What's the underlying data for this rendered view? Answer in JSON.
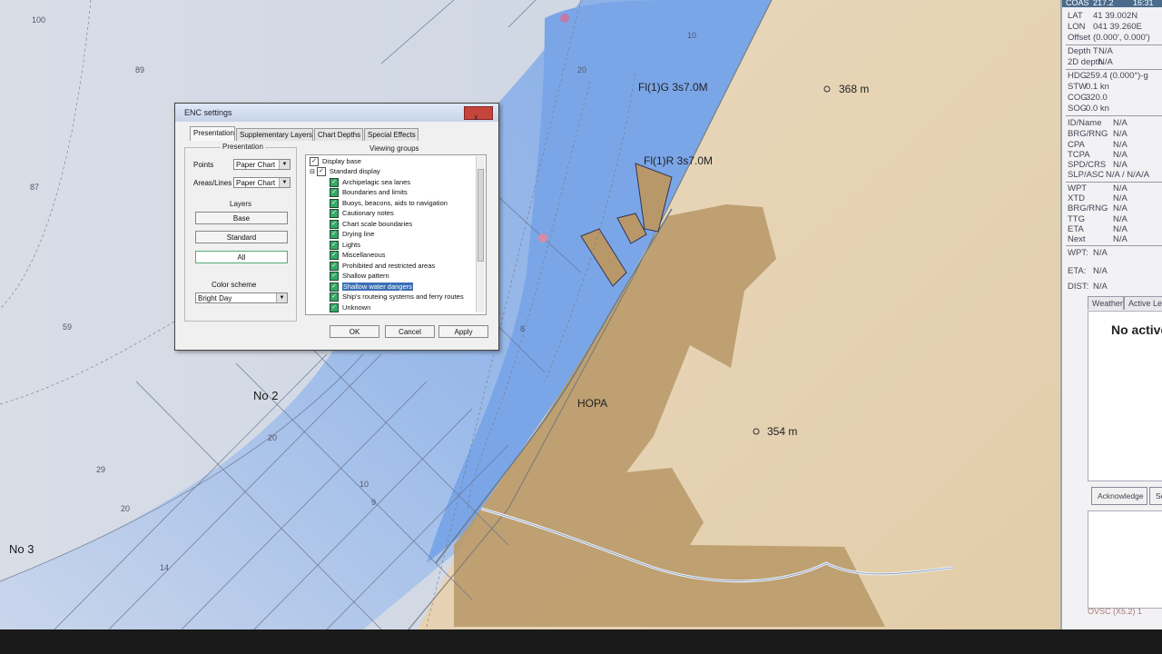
{
  "chart_labels": {
    "light1": "Fl(1)G 3s7.0M",
    "light2": "Fl(1)R 3s7.0M",
    "height1": "368 m",
    "height2": "354 m",
    "town": "HOPA",
    "area_no2": "No 2",
    "area_no3": "No 3",
    "depths": [
      "100",
      "89",
      "87",
      "59",
      "29",
      "20",
      "20",
      "10",
      "9",
      "14",
      "20",
      "8",
      "10"
    ]
  },
  "panel": {
    "top": [
      "COAS",
      "217.2",
      "16:31"
    ],
    "lat_k": "LAT",
    "lat_v": "41 39.002N",
    "lon_k": "LON",
    "lon_v": "041 39.260E",
    "off_k": "Offset",
    "off_v": "(0.000', 0.000')",
    "dep_k": "Depth T",
    "dep_v": "N/A",
    "d2_k": "2D depth",
    "d2_v": "N/A",
    "hdg_k": "HDG",
    "hdg_v": "259.4 (0.000°)-g",
    "stw_k": "STW",
    "stw_v": "0.1 kn",
    "cog_k": "COG",
    "cog_v": "320.0",
    "sog_k": "SOG",
    "sog_v": "0.0 kn",
    "id_k": "ID/Name",
    "id_v": "N/A",
    "brg_k": "BRG/RNG",
    "brg_v": "N/A",
    "cpa_k": "CPA",
    "cpa_v": "N/A",
    "tcpa_k": "TCPA",
    "tcpa_v": "N/A",
    "spd_k": "SPD/CRS",
    "spd_v": "N/A",
    "slp_k": "SLP/ASC",
    "slp_v": "N/A / N/A/A",
    "wpt_k": "WPT",
    "wpt_v": "N/A",
    "xtd_k": "XTD",
    "xtd_v": "N/A",
    "brg2_k": "BRG/RNG",
    "brg2_v": "N/A",
    "ttg_k": "TTG",
    "ttg_v": "N/A",
    "eta_k": "ETA",
    "eta_v": "N/A",
    "next_k": "Next",
    "next_v": "N/A",
    "wpt2_k": "WPT:",
    "wpt2_v": "N/A",
    "eta2_k": "ETA:",
    "eta2_v": "N/A",
    "dist_k": "DIST:",
    "dist_v": "N/A",
    "tab_weather": "Weather",
    "tab_active": "Active Le",
    "alarm_text": "No active",
    "btn_ack": "Acknowledge",
    "btn_sel": "Sel",
    "status": "OVSC (X5.2) 1"
  },
  "dialog": {
    "title": "ENC settings",
    "close": "x",
    "tabs": [
      "Presentation",
      "Supplementary Layers",
      "Chart Depths",
      "Special Effects"
    ],
    "presentation_group": "Presentation",
    "points_label": "Points",
    "points_value": "Paper Chart",
    "areas_label": "Areas/Lines",
    "areas_value": "Paper Chart",
    "layers_group": "Layers",
    "layer_buttons": [
      "Base",
      "Standard",
      "All"
    ],
    "color_scheme_label": "Color scheme",
    "color_scheme_value": "Bright Day",
    "viewing_group": "Viewing groups",
    "items": [
      {
        "label": "Display base",
        "level": 0
      },
      {
        "label": "Standard display",
        "level": 0
      },
      {
        "label": "Archipelagic sea lanes",
        "level": 1
      },
      {
        "label": "Boundaries and limits",
        "level": 1
      },
      {
        "label": "Buoys, beacons, aids to navigation",
        "level": 1
      },
      {
        "label": "Cautionary notes",
        "level": 1
      },
      {
        "label": "Chart scale boundaries",
        "level": 1
      },
      {
        "label": "Drying line",
        "level": 1
      },
      {
        "label": "Lights",
        "level": 1
      },
      {
        "label": "Miscellaneous",
        "level": 1
      },
      {
        "label": "Prohibited and restricted areas",
        "level": 1
      },
      {
        "label": "Shallow pattern",
        "level": 1
      },
      {
        "label": "Shallow water dangers",
        "level": 1
      },
      {
        "label": "Ship's routeing systems and ferry routes",
        "level": 1
      },
      {
        "label": "Unknown",
        "level": 1
      }
    ],
    "ok": "OK",
    "cancel": "Cancel",
    "apply": "Apply"
  }
}
